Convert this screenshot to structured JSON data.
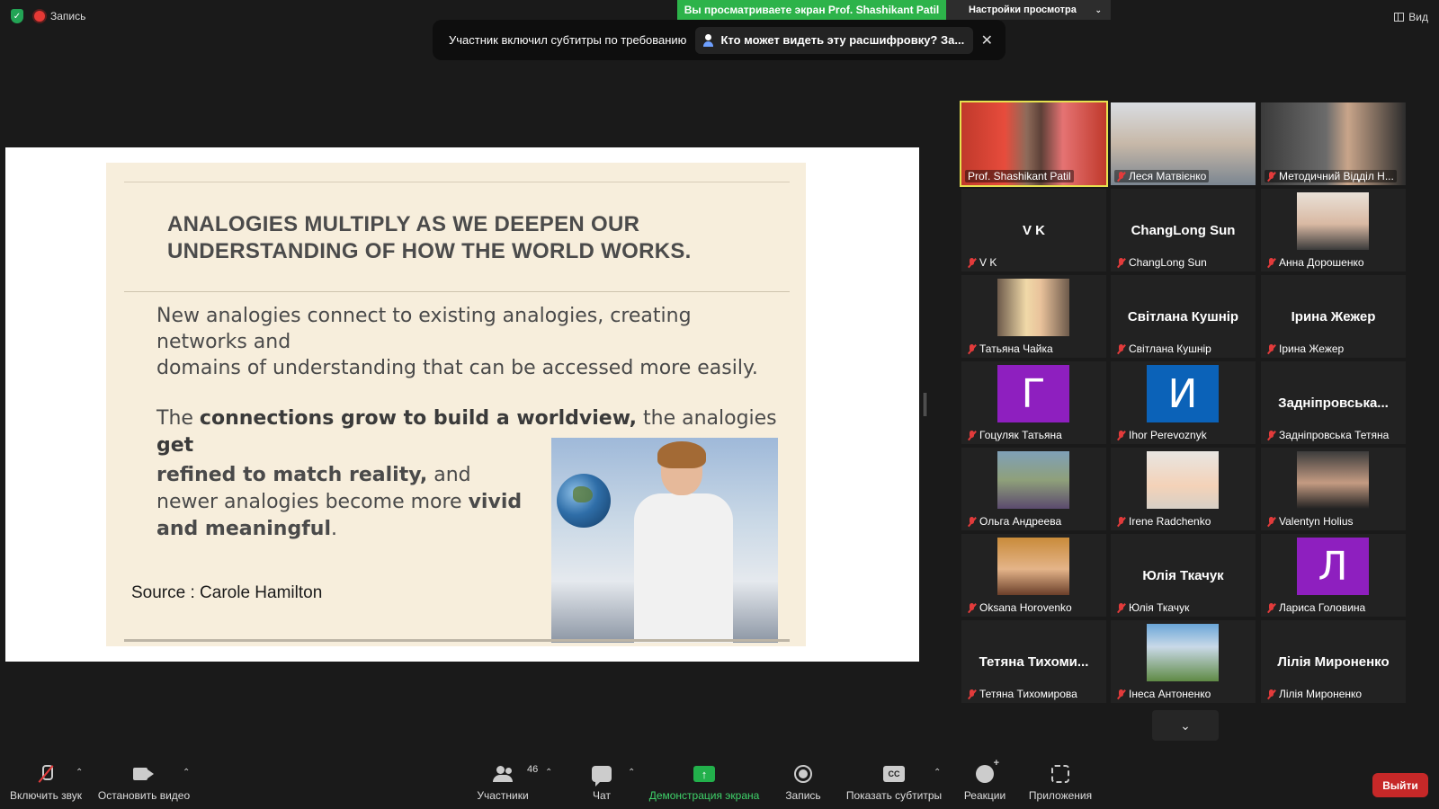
{
  "top_left": {
    "record_label": "Запись"
  },
  "banner": {
    "viewing_text": "Вы просматриваете экран Prof. Shashikant Patil",
    "settings_label": "Настройки просмотра"
  },
  "top_right": {
    "view_label": "Вид"
  },
  "captions": {
    "text": "Участник включил субтитры по требованию",
    "who_label": "Кто может видеть эту расшифровку? За..."
  },
  "slide": {
    "title_line1": "ANALOGIES MULTIPLY AS WE DEEPEN OUR",
    "title_line2": "UNDERSTANDING OF HOW THE WORLD WORKS.",
    "p1": "New analogies connect to existing analogies, creating networks and",
    "p1b": "domains of understanding that can be accessed more easily.",
    "p2_start": "The ",
    "p2_bold1": "connections grow to build a worldview,",
    "p2_mid": " the analogies ",
    "p2_bold2": "get",
    "p3_bold1": "refined to match reality,",
    "p3_mid": " and newer analogies become more ",
    "p3_bold2": "vivid and meaningful",
    "p3_end": ".",
    "source": "Source : Carole Hamilton"
  },
  "participants": [
    {
      "name": "Prof. Shashikant Patil",
      "type": "video",
      "active": true
    },
    {
      "name": "Леся Матвієнко",
      "type": "video"
    },
    {
      "name": "Методичний Відділ Н...",
      "type": "video"
    },
    {
      "name": "V K",
      "display": "V K",
      "type": "name"
    },
    {
      "name": "ChangLong Sun",
      "display": "ChangLong Sun",
      "type": "name"
    },
    {
      "name": "Анна Дорошенко",
      "type": "photo"
    },
    {
      "name": "Татьяна Чайка",
      "type": "photo"
    },
    {
      "name": "Світлана Кушнір",
      "display": "Світлана Кушнір",
      "type": "name"
    },
    {
      "name": "Ірина Жежер",
      "display": "Ірина Жежер",
      "type": "name"
    },
    {
      "name": "Гоцуляк Татьяна",
      "letter": "Г",
      "color": "#8e1fbf",
      "type": "letter"
    },
    {
      "name": "Ihor Perevoznyk",
      "letter": "И",
      "color": "#0b62b8",
      "type": "letter"
    },
    {
      "name": "Задніпровська Тетяна",
      "display": "Задніпровська...",
      "type": "name"
    },
    {
      "name": "Ольга Андреева",
      "type": "photo"
    },
    {
      "name": "Irene Radchenko",
      "type": "photo"
    },
    {
      "name": "Valentyn Holius",
      "type": "photo"
    },
    {
      "name": "Oksana Horovenko",
      "type": "photo"
    },
    {
      "name": "Юлія Ткачук",
      "display": "Юлія Ткачук",
      "type": "name"
    },
    {
      "name": "Лариса Головина",
      "letter": "Л",
      "color": "#8e1fbf",
      "type": "letter"
    },
    {
      "name": "Тетяна Тихомирова",
      "display": "Тетяна Тихоми...",
      "type": "name"
    },
    {
      "name": "Інеса Антоненко",
      "type": "photo"
    },
    {
      "name": "Лілія Мироненко",
      "display": "Лілія Мироненко",
      "type": "name"
    }
  ],
  "toolbar": {
    "unmute": "Включить звук",
    "stop_video": "Остановить видео",
    "participants": "Участники",
    "participants_count": "46",
    "chat": "Чат",
    "share_screen": "Демонстрация экрана",
    "record": "Запись",
    "show_captions": "Показать субтитры",
    "captions_icon": "CC",
    "reactions": "Реакции",
    "apps": "Приложения",
    "leave": "Выйти"
  }
}
